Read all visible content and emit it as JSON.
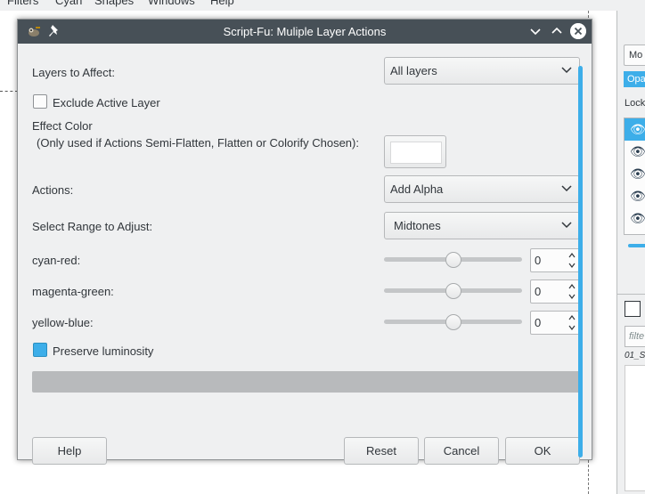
{
  "app": {
    "menu": [
      "Filters",
      "Cyan",
      "Shapes",
      "Windows",
      "Help"
    ],
    "right_panel": {
      "mode_label": "Mo",
      "opacity_label": "Opa",
      "lock_label": "Lock",
      "filter_placeholder": "filte",
      "file_label": "01_S"
    }
  },
  "dialog": {
    "title": "Script-Fu: Muliple Layer Actions",
    "fields": {
      "layers_to_affect": {
        "label": "Layers to Affect:",
        "value": "All layers"
      },
      "exclude_active": {
        "label": "Exclude Active Layer",
        "checked": false
      },
      "effect_color": {
        "label": "Effect Color",
        "sublabel": "(Only used if Actions Semi-Flatten, Flatten or Colorify Chosen):",
        "value": "#ffffff"
      },
      "actions": {
        "label": "Actions:",
        "value": "Add Alpha"
      },
      "range": {
        "label": "Select Range to Adjust:",
        "value": "Midtones"
      },
      "cyan_red": {
        "label": "cyan-red:",
        "value": "0",
        "min": -100,
        "max": 100,
        "current": 0
      },
      "magenta_green": {
        "label": "magenta-green:",
        "value": "0",
        "min": -100,
        "max": 100,
        "current": 0
      },
      "yellow_blue": {
        "label": "yellow-blue:",
        "value": "0",
        "min": -100,
        "max": 100,
        "current": 0
      },
      "preserve_luminosity": {
        "label": "Preserve luminosity",
        "checked": true
      }
    },
    "progress": 0,
    "buttons": {
      "help": "Help",
      "reset": "Reset",
      "cancel": "Cancel",
      "ok": "OK"
    }
  },
  "colors": {
    "titlebar": "#475057",
    "accent": "#3daee9",
    "dialog_bg": "#eff0f1"
  }
}
